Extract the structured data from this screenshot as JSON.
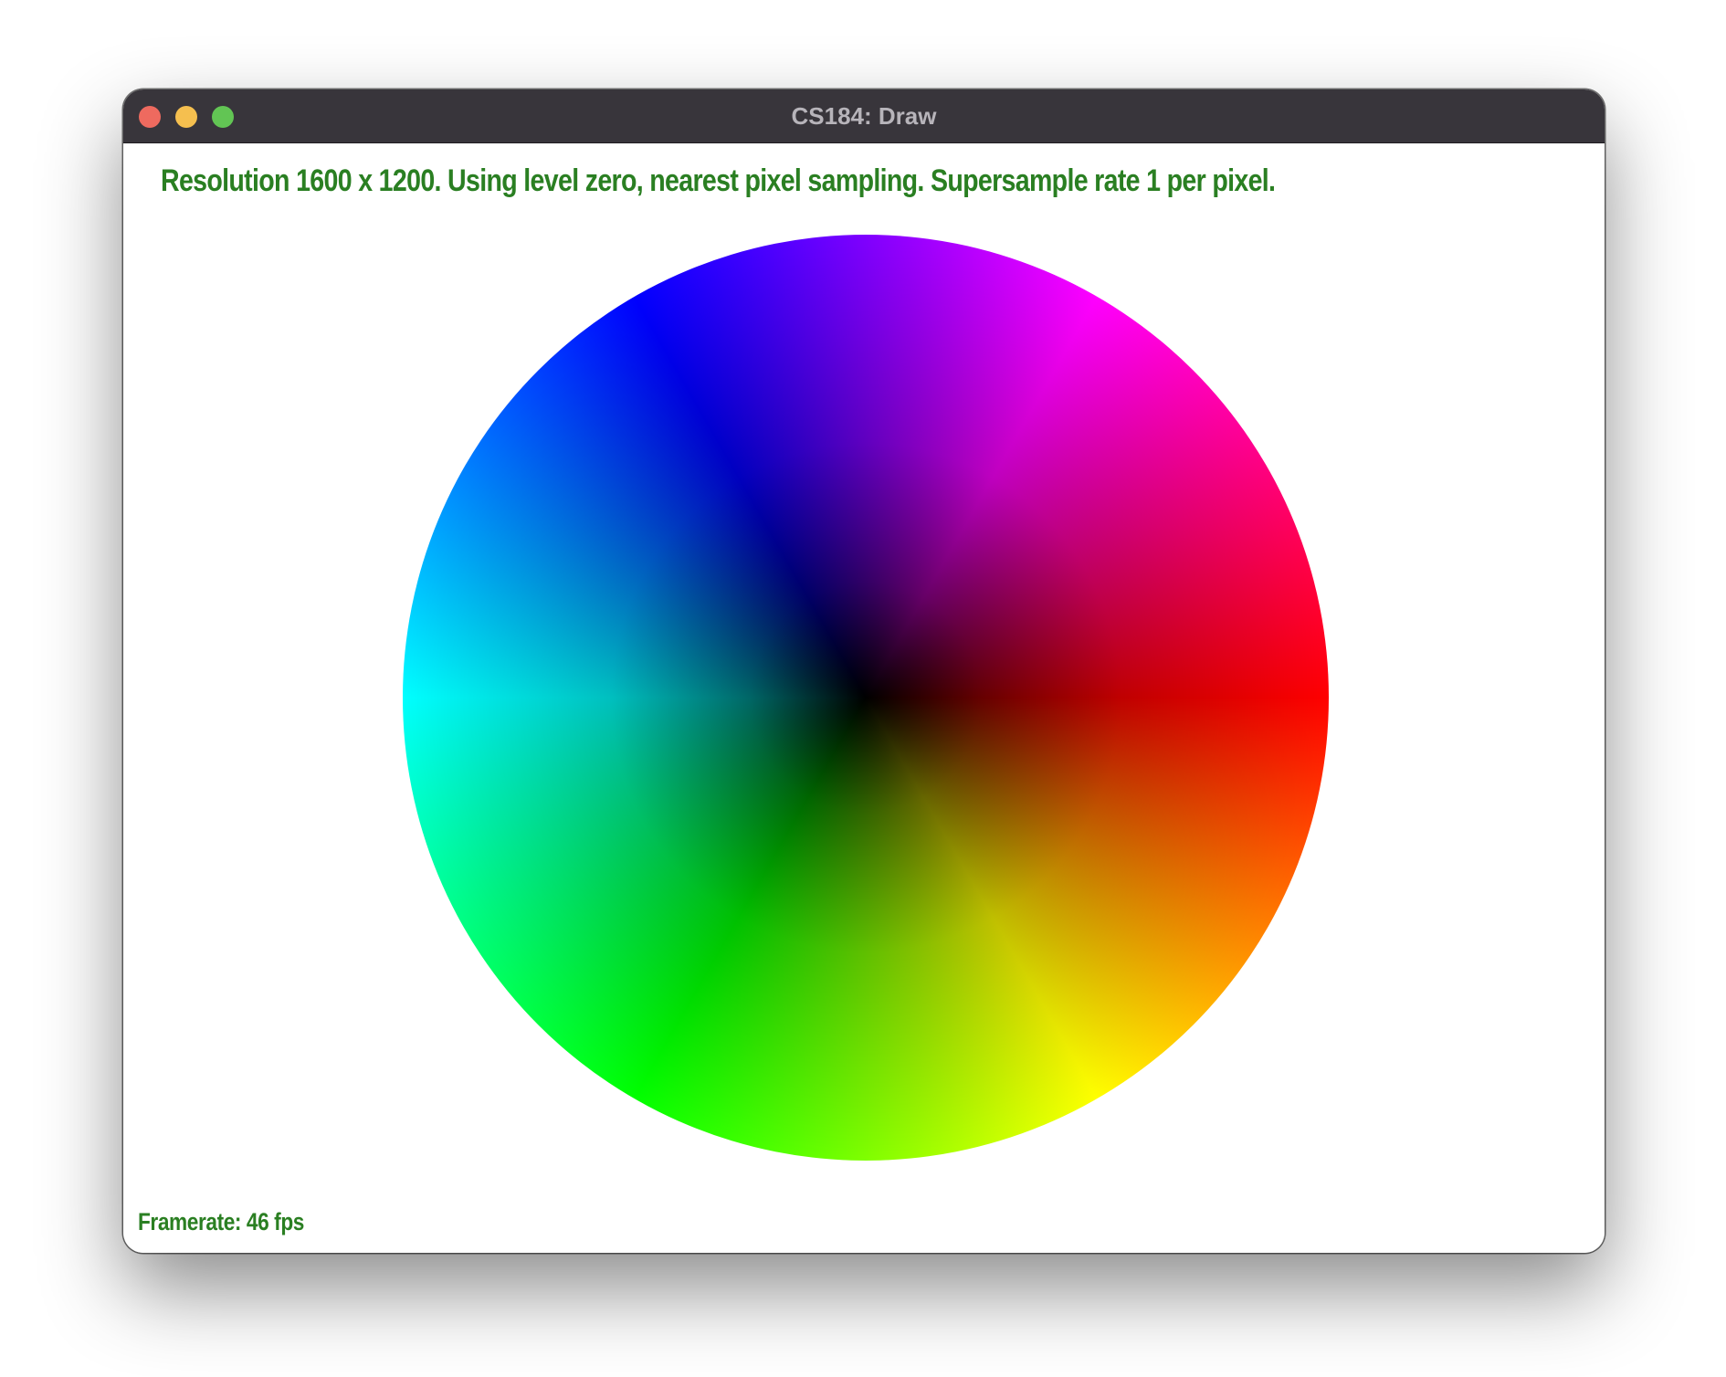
{
  "window": {
    "title": "CS184: Draw",
    "controls": {
      "close_color": "#ee6a5f",
      "minimize_color": "#f5bf4f",
      "maximize_color": "#62c554"
    }
  },
  "canvas": {
    "info_text": "Resolution 1600 x 1200. Using level zero, nearest pixel sampling. Supersample rate 1 per pixel.",
    "framerate_text": "Framerate: 46 fps",
    "text_color": "#2a7f22",
    "shape": "color-wheel"
  }
}
